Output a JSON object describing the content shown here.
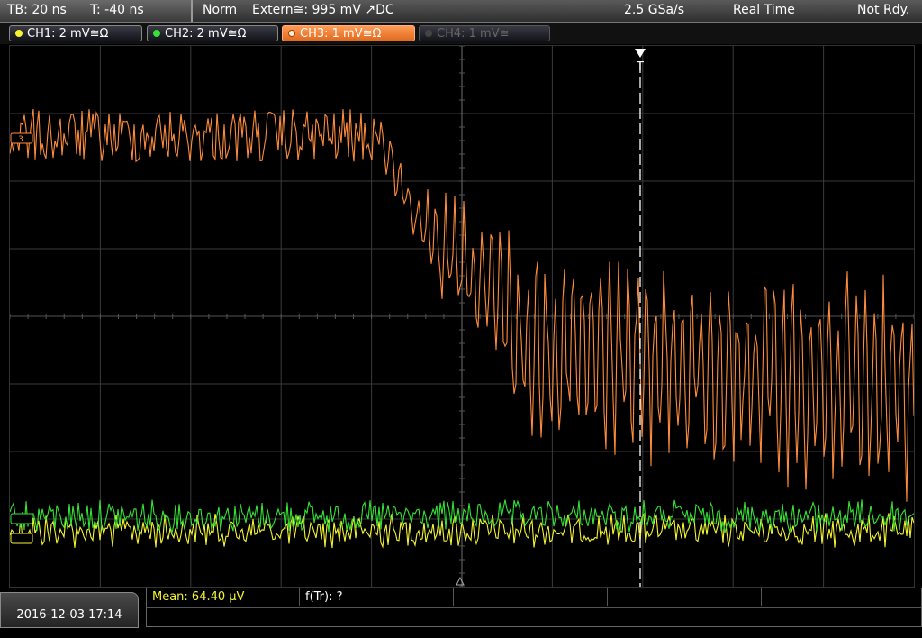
{
  "header": {
    "timebase": "TB: 20 ns",
    "trigger_time": "T: -40 ns",
    "mode": "Norm",
    "trigger_source": "Extern≅: 995 mV ↗DC",
    "sample_rate": "2.5 GSa/s",
    "acq_mode": "Real Time",
    "status": "Not Rdy."
  },
  "channels": [
    {
      "label": "CH1: 2 mV≅Ω",
      "color": "#f5f532",
      "active": true
    },
    {
      "label": "CH2: 2 mV≅Ω",
      "color": "#35e235",
      "active": true
    },
    {
      "label": "CH3: 1 mV≅Ω",
      "color": "#ff8c3c",
      "active": true,
      "selected": true
    },
    {
      "label": "CH4: 1 mV≅",
      "color": "#6a6a6a",
      "active": false
    }
  ],
  "screen": {
    "trigger_marker": "T",
    "ch3_marker": "3"
  },
  "footer": {
    "datetime": "2016-12-03 17:14",
    "mean": "Mean: 64.40 µV",
    "f_tr": "f(Tr): ?"
  },
  "colors": {
    "ch1": "#f5f532",
    "ch2": "#35e235",
    "ch3": "#ff8c3c",
    "grid": "#3a3a3a"
  }
}
